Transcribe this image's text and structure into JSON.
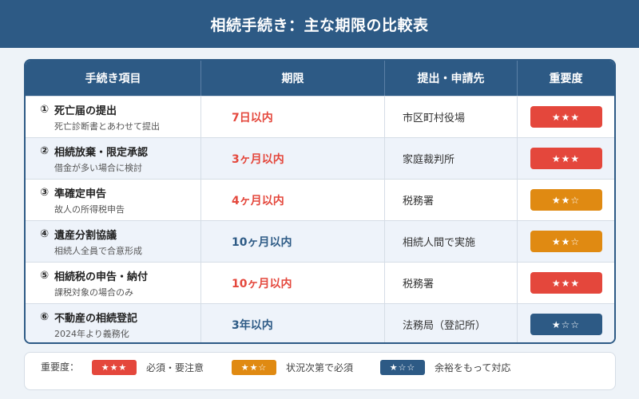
{
  "header": {
    "title": "相続手続き：主な期限の比較表"
  },
  "columns": [
    "手続き項目",
    "期限",
    "提出・申請先",
    "重要度"
  ],
  "colors": {
    "header_bg": "#2d5a85",
    "high": "#e4473c",
    "medium": "#e08a12",
    "low": "#2d5a85"
  },
  "rows": [
    {
      "num": "①",
      "name": "死亡届の提出",
      "note": "死亡診断書とあわせて提出",
      "deadline": "7日以内",
      "deadline_color": "#e4473c",
      "office": "市区町村役場",
      "stars": "★★★",
      "level": "high"
    },
    {
      "num": "②",
      "name": "相続放棄・限定承認",
      "note": "借金が多い場合に検討",
      "deadline": "3ヶ月以内",
      "deadline_color": "#e4473c",
      "office": "家庭裁判所",
      "stars": "★★★",
      "level": "high"
    },
    {
      "num": "③",
      "name": "準確定申告",
      "note": "故人の所得税申告",
      "deadline": "4ヶ月以内",
      "deadline_color": "#e4473c",
      "office": "税務署",
      "stars": "★★☆",
      "level": "medium"
    },
    {
      "num": "④",
      "name": "遺産分割協議",
      "note": "相続人全員で合意形成",
      "deadline": "10ヶ月以内",
      "deadline_color": "#2d5a85",
      "office": "相続人間で実施",
      "stars": "★★☆",
      "level": "medium"
    },
    {
      "num": "⑤",
      "name": "相続税の申告・納付",
      "note": "課税対象の場合のみ",
      "deadline": "10ヶ月以内",
      "deadline_color": "#e4473c",
      "office": "税務署",
      "stars": "★★★",
      "level": "high"
    },
    {
      "num": "⑥",
      "name": "不動産の相続登記",
      "note": "2024年より義務化",
      "deadline": "3年以内",
      "deadline_color": "#2d5a85",
      "office": "法務局（登記所）",
      "stars": "★☆☆",
      "level": "low"
    }
  ],
  "legend": {
    "label": "重要度：",
    "items": [
      {
        "stars": "★★★",
        "text": "必須・要注意",
        "level": "high"
      },
      {
        "stars": "★★☆",
        "text": "状況次第で必須",
        "level": "medium"
      },
      {
        "stars": "★☆☆",
        "text": "余裕をもって対応",
        "level": "low"
      }
    ]
  }
}
